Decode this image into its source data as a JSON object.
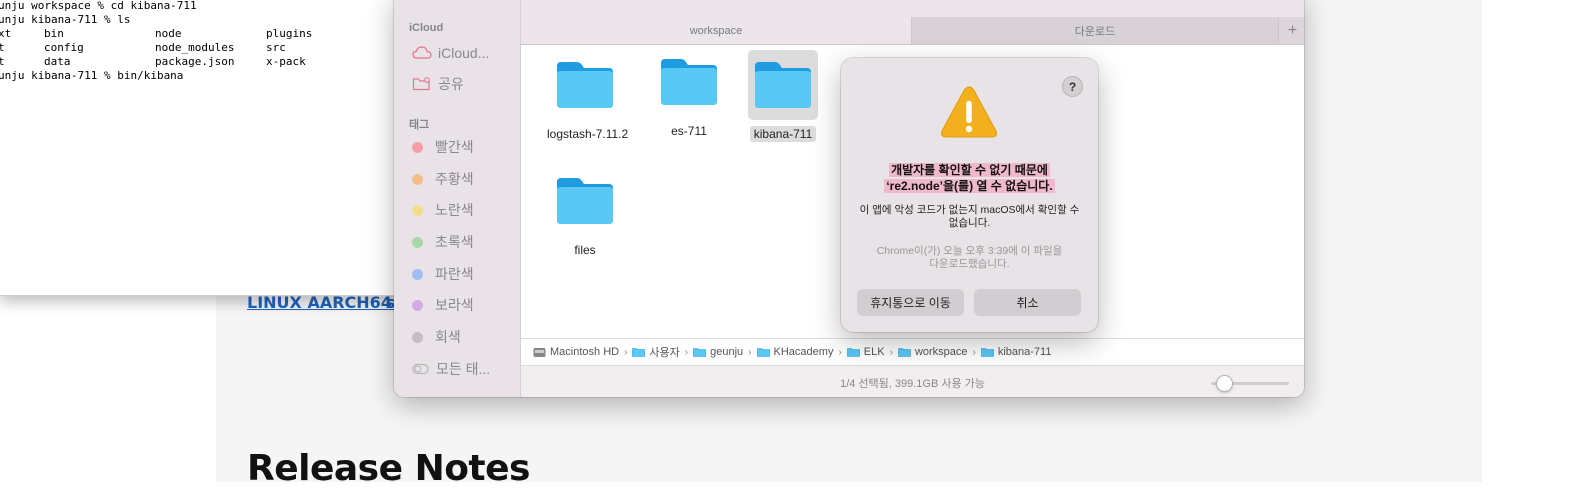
{
  "web": {
    "download_link": "LINUX AARCH64",
    "download_link2": "s",
    "heading": "Release Notes"
  },
  "terminal": {
    "lines": [
      "unju workspace % cd kibana-711",
      "unju kibana-711 % ls",
      "unju kibana-711 % bin/kibana"
    ],
    "ls_rows": [
      [
        "xt",
        "bin",
        "node",
        "plugins"
      ],
      [
        "t",
        "config",
        "node_modules",
        "src"
      ],
      [
        "t",
        "data",
        "package.json",
        "x-pack"
      ]
    ]
  },
  "finder": {
    "sidebar": {
      "icloud_header": "iCloud",
      "icloud_drive": "iCloud...",
      "shared": "공유",
      "tags_header": "태그",
      "tags": [
        {
          "label": "빨간색",
          "color": "#f2a0a6"
        },
        {
          "label": "주황색",
          "color": "#f4be8c"
        },
        {
          "label": "노란색",
          "color": "#f3dd8c"
        },
        {
          "label": "초록색",
          "color": "#a6d9a8"
        },
        {
          "label": "파란색",
          "color": "#a3bef2"
        },
        {
          "label": "보라색",
          "color": "#d5a9e6"
        },
        {
          "label": "회색",
          "color": "#c3bfc2"
        }
      ],
      "all_tags": "모든 태..."
    },
    "tabs": [
      "workspace",
      "다운로드"
    ],
    "items": [
      "logstash-7.11.2",
      "es-711",
      "kibana-711",
      "files"
    ],
    "path": [
      "Macintosh HD",
      "사용자",
      "geunju",
      "KHacademy",
      "ELK",
      "workspace",
      "kibana-711"
    ],
    "status": "1/4 선택됨, 399.1GB 사용 가능"
  },
  "alert": {
    "help": "?",
    "title_line1": "개발자를 확인할 수 없기 때문에",
    "title_line2": "‘re2.node’을(를) 열 수 없습니다.",
    "body": "이 앱에 악성 코드가 없는지 macOS에서 확인할 수 없습니다.",
    "note": "Chrome이(가) 오늘 오후 3:39에 이 파일을 다운로드했습니다.",
    "trash_button": "휴지통으로 이동",
    "cancel_button": "취소"
  }
}
